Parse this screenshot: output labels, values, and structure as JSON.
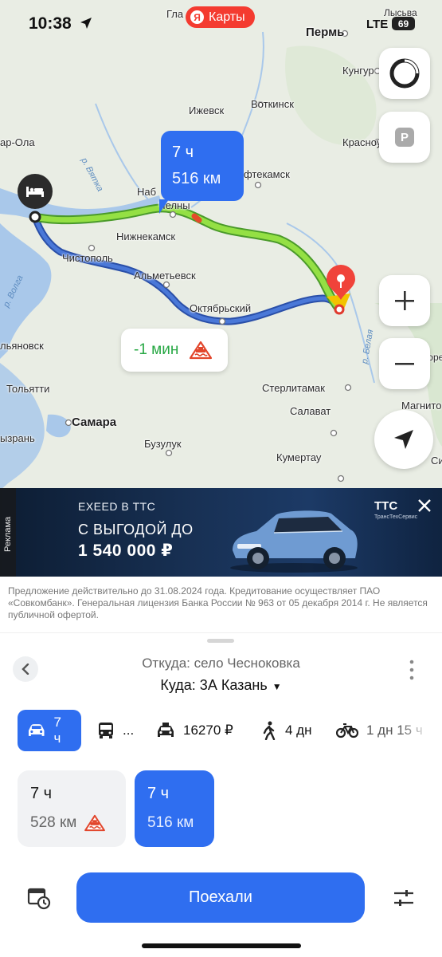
{
  "status_bar": {
    "time": "10:38",
    "network": "LTE",
    "battery": "69"
  },
  "brand": {
    "logo_letter": "Я",
    "name": "Карты"
  },
  "map": {
    "cities": {
      "glazov": "Гла",
      "lysva": "Лысьва",
      "perm": "Пермь",
      "kungur": "Кунгур",
      "izhevsk": "Ижевск",
      "votkinsk": "Воткинск",
      "yoshkar_ola": "ар-Ола",
      "krasnoufimsk": "Красноуф",
      "neftekamsk": "фтекамск",
      "nab": "Наб",
      "chelny": "Челны",
      "nizhnekamsk": "Нижнекамск",
      "chistopol": "Чистополь",
      "almetyevsk": "Альметьевск",
      "oktyabrsky": "Октябрьский",
      "ulyanovsk": "льяновск",
      "tolyatti": "Тольятти",
      "samara": "Самара",
      "syzran": "ызрань",
      "buzuluk": "Бузулук",
      "sterlitamak": "Стерлитамак",
      "salavat": "Салават",
      "kumertau": "Кумертау",
      "magnitogorsk": "Магнито",
      "beloretsk": "Белорец",
      "edge_s": "Си"
    },
    "rivers": {
      "vyatka": "р. Вятка",
      "volga": "р. Волга",
      "belaya": "р. Белая"
    },
    "route_callout": {
      "time": "7 ч",
      "distance": "516 км"
    },
    "alt_callout": {
      "delta": "-1 мин"
    }
  },
  "ad": {
    "tag": "Реклама",
    "line1": "EXEED В ТТС",
    "line2": "С ВЫГОДОЙ ДО",
    "line3": "1 540 000 ₽",
    "brand": "ТТС",
    "brand_sub": "ТрансТехСервис",
    "disclaimer": "Предложение действительно до 31.08.2024 года. Кредитование осуществляет ПАО «Совкомбанк». Генеральная лицензия Банка России № 963 от 05 декабря 2014 г. Не является публичной офертой."
  },
  "route": {
    "from": "Откуда: село Чесноковка",
    "to": "Куда: 3А Казань",
    "caret": "▼"
  },
  "modes": {
    "car": "7 ч",
    "transit": "...",
    "taxi": "16270 ₽",
    "walk": "4 дн",
    "bike": "1 дн 15 ч"
  },
  "variants": [
    {
      "time": "7 ч",
      "distance": "528 км"
    },
    {
      "time": "7 ч",
      "distance": "516 км"
    }
  ],
  "actions": {
    "go": "Поехали"
  },
  "colors": {
    "accent": "#2f6ef0",
    "route_main": "#8fdc3a",
    "route_alt": "#3a64c0",
    "brand_red": "#f43b30",
    "ok_green": "#27a844"
  }
}
